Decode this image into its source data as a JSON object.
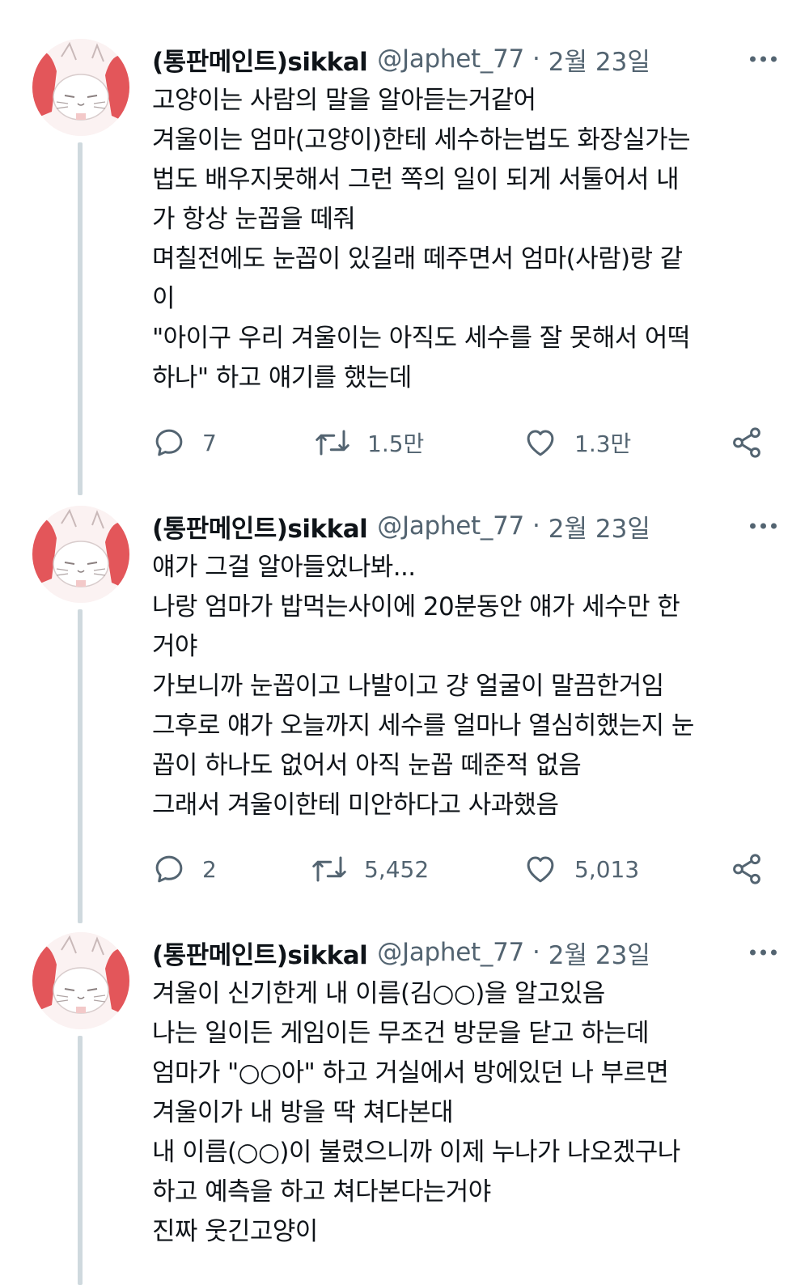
{
  "tweets": [
    {
      "name": "(통판메인트)sikkal",
      "handle": "@Japhet_77",
      "separator": "·",
      "date": "2월 23일",
      "lines": [
        "고양이는 사람의 말을 알아듣는거같어",
        "겨울이는 엄마(고양이)한테 세수하는법도 화장실가는",
        "법도 배우지못해서 그런 쪽의 일이 되게 서툴어서 내",
        "가 항상 눈꼽을 떼줘",
        "며칠전에도 눈꼽이 있길래 떼주면서 엄마(사람)랑 같",
        "이",
        "\"아이구 우리 겨울이는 아직도 세수를 잘 못해서 어떡",
        "하나\" 하고 얘기를 했는데"
      ],
      "replies": "7",
      "retweets": "1.5만",
      "likes": "1.3만"
    },
    {
      "name": "(통판메인트)sikkal",
      "handle": "@Japhet_77",
      "separator": "·",
      "date": "2월 23일",
      "lines": [
        "얘가 그걸 알아들었나봐...",
        "나랑 엄마가 밥먹는사이에 20분동안 얘가 세수만 한",
        "거야",
        "가보니까 눈꼽이고 나발이고 걍 얼굴이 말끔한거임",
        "그후로 얘가 오늘까지 세수를 얼마나 열심히했는지 눈",
        "꼽이 하나도 없어서 아직 눈꼽 떼준적 없음",
        "그래서 겨울이한테 미안하다고 사과했음"
      ],
      "replies": "2",
      "retweets": "5,452",
      "likes": "5,013"
    },
    {
      "name": "(통판메인트)sikkal",
      "handle": "@Japhet_77",
      "separator": "·",
      "date": "2월 23일",
      "lines": [
        "겨울이 신기한게 내 이름(김○○)을 알고있음",
        "나는 일이든 게임이든 무조건 방문을 닫고 하는데",
        "엄마가 \"○○아\" 하고 거실에서 방에있던 나 부르면",
        "겨울이가 내 방을 딱 쳐다본대",
        "내 이름(○○)이 불렸으니까 이제 누나가 나오겠구나",
        "하고 예측을 하고 쳐다본다는거야",
        "진짜 웃긴고양이"
      ]
    }
  ],
  "icons": {
    "reply": "reply-bubble-icon",
    "retweet": "retweet-arrows-icon",
    "like": "heart-icon",
    "share": "share-icon",
    "more": "more-dots-icon"
  },
  "colors": {
    "text": "#0f1419",
    "secondary": "#536471",
    "thread_line": "#cfd9de",
    "avatar_accent": "#e3565a"
  }
}
